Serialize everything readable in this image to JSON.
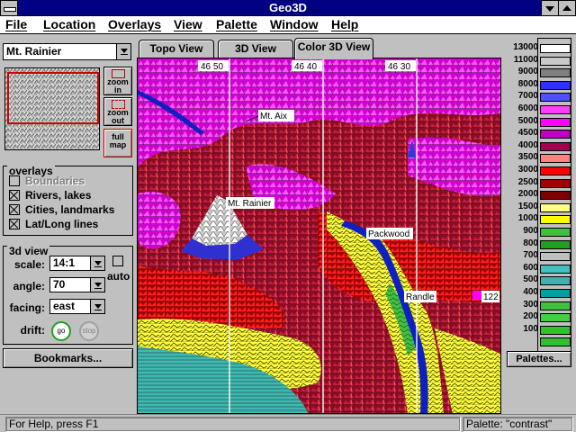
{
  "app": {
    "title": "Geo3D"
  },
  "menu": [
    {
      "label": "File"
    },
    {
      "label": "Location"
    },
    {
      "label": "Overlays"
    },
    {
      "label": "View"
    },
    {
      "label": "Palette"
    },
    {
      "label": "Window"
    },
    {
      "label": "Help"
    }
  ],
  "location": {
    "selected": "Mt. Rainier"
  },
  "zoom": {
    "in_top": "zoom",
    "in_bottom": "in",
    "out_top": "zoom",
    "out_bottom": "out",
    "full_top": "full",
    "full_bottom": "map"
  },
  "overlays": {
    "header": "overlays",
    "items": [
      {
        "label": "Boundaries",
        "checked": false,
        "enabled": false
      },
      {
        "label": "Rivers, lakes",
        "checked": true,
        "enabled": true
      },
      {
        "label": "Cities, landmarks",
        "checked": true,
        "enabled": true
      },
      {
        "label": "Lat/Long lines",
        "checked": true,
        "enabled": true
      }
    ]
  },
  "view3d": {
    "header": "3d view",
    "scale_label": "scale:",
    "scale_value": "14:1",
    "angle_label": "angle:",
    "angle_value": "70",
    "facing_label": "facing:",
    "facing_value": "east",
    "auto_label": "auto",
    "drift_label": "drift:",
    "go_label": "go",
    "stop_label": "stop"
  },
  "bookmarks_label": "Bookmarks...",
  "tabs": [
    {
      "label": "Topo View",
      "active": false
    },
    {
      "label": "3D View",
      "active": false
    },
    {
      "label": "Color 3D View",
      "active": true
    }
  ],
  "map": {
    "longitudes": [
      "46 50",
      "46 40",
      "46 30"
    ],
    "places": [
      "Mt. Aix",
      "Mt. Rainier",
      "Packwood",
      "Randle",
      "122"
    ]
  },
  "legend": [
    {
      "value": "13000",
      "color": "#ffffff"
    },
    {
      "value": "11000",
      "color": "#c8c8c8"
    },
    {
      "value": "9000",
      "color": "#808080"
    },
    {
      "value": "8000",
      "color": "#3030ff"
    },
    {
      "value": "7000",
      "color": "#5050ff"
    },
    {
      "value": "6000",
      "color": "#ff40ff"
    },
    {
      "value": "5000",
      "color": "#ff00ff"
    },
    {
      "value": "4500",
      "color": "#c000c0"
    },
    {
      "value": "4000",
      "color": "#a00050"
    },
    {
      "value": "3500",
      "color": "#ff8080"
    },
    {
      "value": "3000",
      "color": "#ff0000"
    },
    {
      "value": "2500",
      "color": "#a00000"
    },
    {
      "value": "2000",
      "color": "#800000"
    },
    {
      "value": "1500",
      "color": "#ffff80"
    },
    {
      "value": "1000",
      "color": "#ffff00"
    },
    {
      "value": "900",
      "color": "#40c040"
    },
    {
      "value": "800",
      "color": "#20a020"
    },
    {
      "value": "700",
      "color": "#c0c0c0"
    },
    {
      "value": "600",
      "color": "#40c0c0"
    },
    {
      "value": "500",
      "color": "#40b0b0"
    },
    {
      "value": "400",
      "color": "#00a0a0"
    },
    {
      "value": "300",
      "color": "#40c040"
    },
    {
      "value": "200",
      "color": "#40d040"
    },
    {
      "value": "100",
      "color": "#30c030"
    },
    {
      "value": "",
      "color": "#30c030"
    }
  ],
  "palettes_label": "Palettes...",
  "status": {
    "help": "For Help, press F1",
    "palette": "Palette: \"contrast\""
  }
}
